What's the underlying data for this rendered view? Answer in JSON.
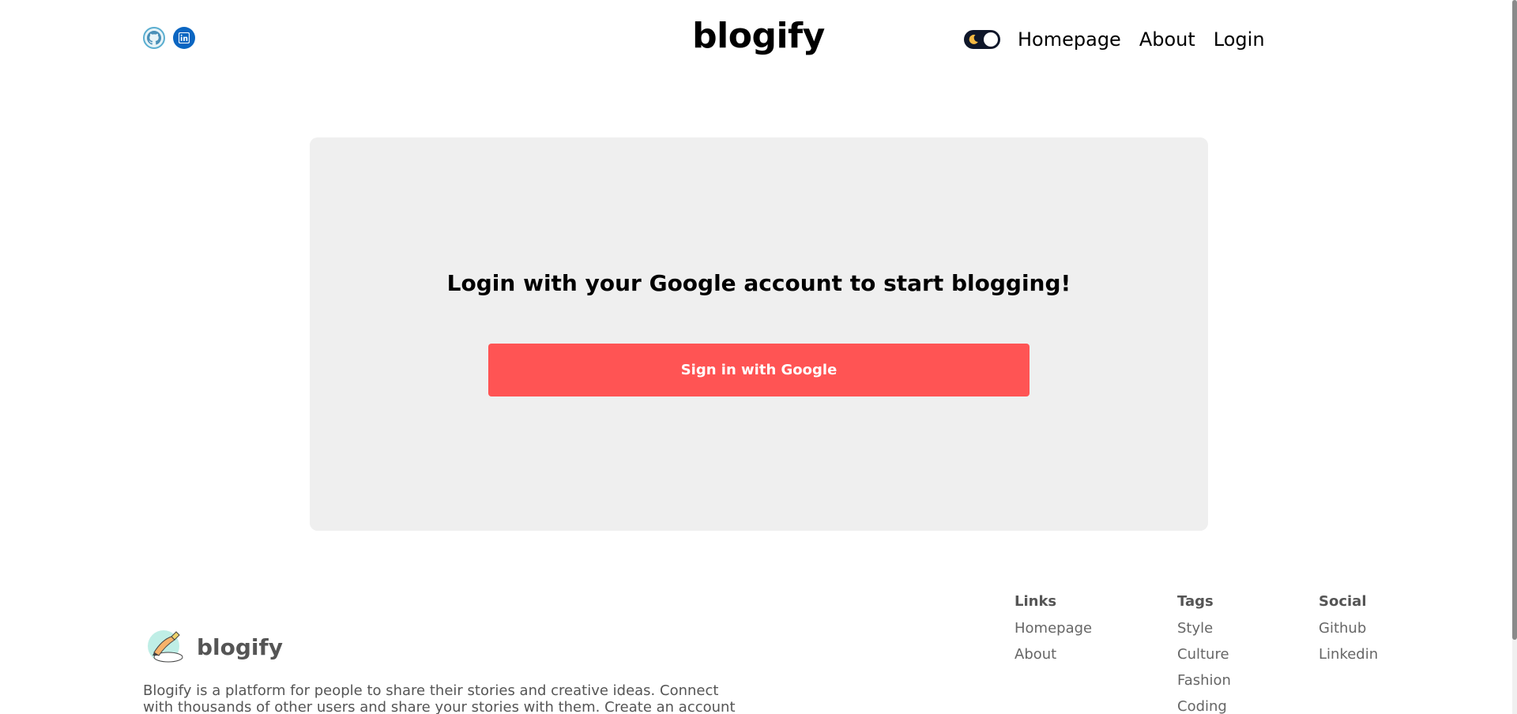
{
  "header": {
    "logo": "blogify",
    "social_icons": [
      "github-icon",
      "linkedin-icon"
    ],
    "nav": {
      "homepage": "Homepage",
      "about": "About",
      "login": "Login"
    },
    "theme_toggle_icon": "moon-icon"
  },
  "login": {
    "heading": "Login with your Google account to start blogging!",
    "button_label": "Sign in with Google"
  },
  "footer": {
    "brand_name": "blogify",
    "description": "Blogify is a platform for people to share their stories and creative ideas. Connect with thousands of other users and share your stories with them. Create an account today and",
    "columns": {
      "links": {
        "title": "Links",
        "items": [
          "Homepage",
          "About"
        ]
      },
      "tags": {
        "title": "Tags",
        "items": [
          "Style",
          "Culture",
          "Fashion",
          "Coding"
        ]
      },
      "social": {
        "title": "Social",
        "items": [
          "Github",
          "Linkedin"
        ]
      }
    }
  },
  "colors": {
    "accent": "#ff5454",
    "card_bg": "#efefef",
    "toggle_bg": "#0f172a",
    "linkedin": "#0a66c2",
    "muted_text": "#555555"
  }
}
